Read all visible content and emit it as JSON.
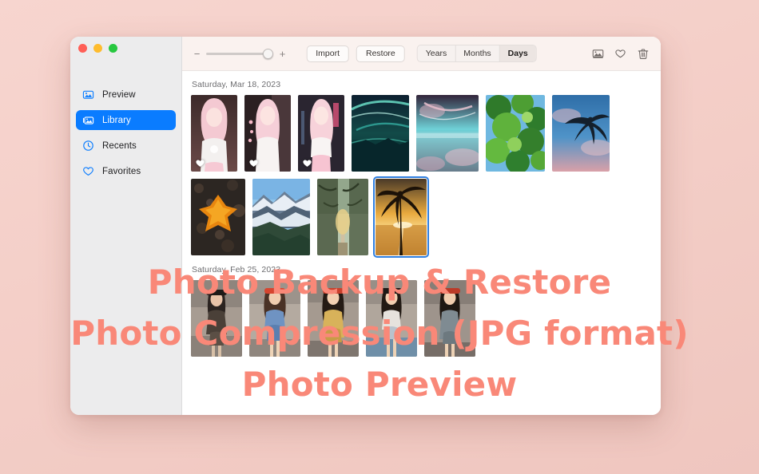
{
  "window": {
    "traffic_lights": [
      "close",
      "minimize",
      "maximize"
    ]
  },
  "sidebar": {
    "items": [
      {
        "label": "Preview",
        "icon": "photo-preview-icon",
        "active": false
      },
      {
        "label": "Library",
        "icon": "photo-library-icon",
        "active": true
      },
      {
        "label": "Recents",
        "icon": "clock-icon",
        "active": false
      },
      {
        "label": "Favorites",
        "icon": "heart-outline-icon",
        "active": false
      }
    ]
  },
  "toolbar": {
    "zoom": {
      "minus_label": "−",
      "plus_label": "+",
      "value_percent": 85
    },
    "import_label": "Import",
    "restore_label": "Restore",
    "segments": [
      {
        "label": "Years",
        "active": false
      },
      {
        "label": "Months",
        "active": false
      },
      {
        "label": "Days",
        "active": true
      }
    ],
    "icons": [
      {
        "name": "photo-icon",
        "title": "Photos"
      },
      {
        "name": "heart-outline-icon",
        "title": "Favorite"
      },
      {
        "name": "trash-icon",
        "title": "Delete"
      }
    ]
  },
  "groups": [
    {
      "date": "Saturday, Mar 18, 2023",
      "rows": [
        [
          {
            "id": "p1",
            "favorite": true,
            "selected": false,
            "art": "girl-pink-1"
          },
          {
            "id": "p2",
            "favorite": true,
            "selected": false,
            "art": "girl-pink-2"
          },
          {
            "id": "p3",
            "favorite": true,
            "selected": false,
            "art": "girl-pink-3"
          },
          {
            "id": "p4",
            "favorite": false,
            "selected": false,
            "art": "aurora-lake"
          },
          {
            "id": "p5",
            "favorite": false,
            "selected": false,
            "art": "pink-sky-lake"
          },
          {
            "id": "p6",
            "favorite": false,
            "selected": false,
            "art": "green-leaves"
          },
          {
            "id": "p7",
            "favorite": false,
            "selected": false,
            "art": "palm-blue-sky"
          }
        ],
        [
          {
            "id": "p8",
            "favorite": false,
            "selected": false,
            "art": "autumn-leaf"
          },
          {
            "id": "p9",
            "favorite": false,
            "selected": false,
            "art": "snow-mountain"
          },
          {
            "id": "p10",
            "favorite": false,
            "selected": false,
            "art": "forest-road"
          },
          {
            "id": "p11",
            "favorite": false,
            "selected": true,
            "art": "palm-sunset"
          }
        ]
      ]
    },
    {
      "date": "Saturday, Feb 25, 2023",
      "rows": [
        [
          {
            "id": "p12",
            "favorite": false,
            "selected": false,
            "art": "street-girl-1"
          },
          {
            "id": "p13",
            "favorite": false,
            "selected": false,
            "art": "street-girl-2"
          },
          {
            "id": "p14",
            "favorite": false,
            "selected": false,
            "art": "street-girl-3"
          },
          {
            "id": "p15",
            "favorite": false,
            "selected": false,
            "art": "street-girl-4"
          },
          {
            "id": "p16",
            "favorite": false,
            "selected": false,
            "art": "street-girl-5"
          }
        ]
      ]
    }
  ],
  "overlay": {
    "lines": [
      "Photo Backup & Restore",
      "Photo Compression (JPG format)",
      "Photo Preview"
    ],
    "color": "#f98878"
  },
  "colors": {
    "accent_blue": "#0a7cff",
    "selection_blue": "#2f7fe0",
    "page_background": "#f3cdc6",
    "toolbar_background": "#faf2ef",
    "sidebar_background": "#ececed"
  }
}
